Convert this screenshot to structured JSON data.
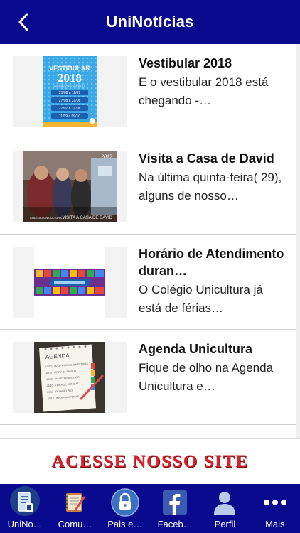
{
  "header": {
    "title": "UniNotícias"
  },
  "news": [
    {
      "title": "Vestibular 2018",
      "description": "E o vestibular 2018 está chegando -…"
    },
    {
      "title": "Visita a Casa de David",
      "description": "Na última quinta-feira( 29), alguns de nosso…"
    },
    {
      "title": "Horário de Atendimento duran…",
      "description": "O Colégio Unicultura já está de férias…"
    },
    {
      "title": "Agenda Unicultura",
      "description": "Fique de olho na Agenda Unicultura e…"
    }
  ],
  "thumbs": {
    "t1_heading": "VESTIBULAR",
    "t1_year": "2018",
    "t1_subtitle": "INSCRIÇÕES ABERTAS",
    "t1_dates": [
      "21/08 a 11/09",
      "27/08 a 31/08",
      "27/07 a 31/08",
      "11/09 a 09/10"
    ],
    "t2_year": "2017",
    "t2_caption": "VISITA A CASA DE DAVID",
    "t2_logo": "COLÉGIO UNICULTURA",
    "t4_heading": "AGENDA",
    "t4_lines": [
      "10/10 - 24/11 - PROVAS BIMESTRAIS",
      "10/10 - FESTA DA FAMÍLIA",
      "15/10 - DIA DO PROFESSOR",
      "21/10 - FEIRA DE CIÊNCIAS",
      "25/10 - REUNIÃO PAIS",
      "30/10 - INÍCIO DAS FÉRIAS"
    ]
  },
  "banner": {
    "text": "ACESSE NOSSO SITE"
  },
  "tabs": [
    {
      "label": "UniNo…",
      "icon": "document-phone-icon"
    },
    {
      "label": "Comu…",
      "icon": "notebook-icon"
    },
    {
      "label": "Pais e…",
      "icon": "lock-icon"
    },
    {
      "label": "Faceb…",
      "icon": "facebook-icon"
    },
    {
      "label": "Perfil",
      "icon": "user-icon"
    },
    {
      "label": "Mais",
      "icon": "more-icon"
    }
  ],
  "colors": {
    "primary": "#0a0a8f",
    "accent": "#d8232a"
  }
}
